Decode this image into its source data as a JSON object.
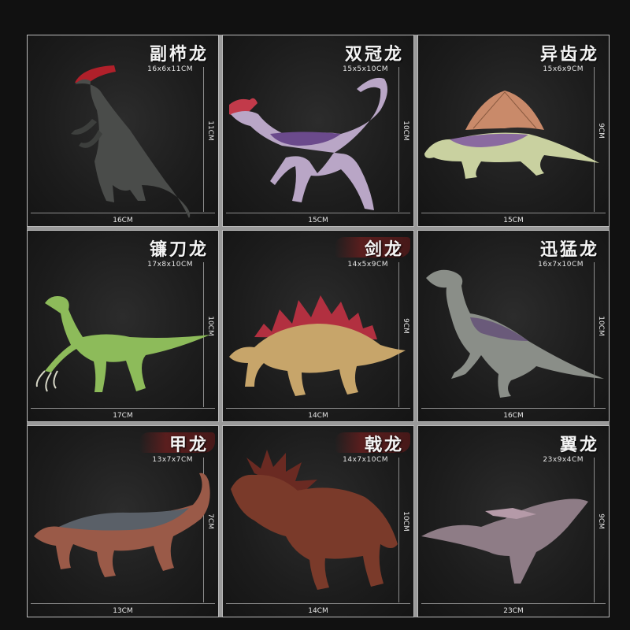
{
  "products": [
    {
      "name": "副栉龙",
      "dims": "16x6x11CM",
      "width_label": "16CM",
      "height_label": "11CM",
      "icon": "parasaurolophus-figure"
    },
    {
      "name": "双冠龙",
      "dims": "15x5x10CM",
      "width_label": "15CM",
      "height_label": "10CM",
      "icon": "dilophosaurus-figure"
    },
    {
      "name": "异齿龙",
      "dims": "15x6x9CM",
      "width_label": "15CM",
      "height_label": "9CM",
      "icon": "dimetrodon-figure"
    },
    {
      "name": "镰刀龙",
      "dims": "17x8x10CM",
      "width_label": "17CM",
      "height_label": "10CM",
      "icon": "therizinosaurus-figure"
    },
    {
      "name": "剑龙",
      "dims": "14x5x9CM",
      "width_label": "14CM",
      "height_label": "9CM",
      "icon": "stegosaurus-figure"
    },
    {
      "name": "迅猛龙",
      "dims": "16x7x10CM",
      "width_label": "16CM",
      "height_label": "10CM",
      "icon": "velociraptor-figure"
    },
    {
      "name": "甲龙",
      "dims": "13x7x7CM",
      "width_label": "13CM",
      "height_label": "7CM",
      "icon": "ankylosaurus-figure"
    },
    {
      "name": "戟龙",
      "dims": "14x7x10CM",
      "width_label": "14CM",
      "height_label": "10CM",
      "icon": "styracosaurus-figure"
    },
    {
      "name": "翼龙",
      "dims": "23x9x4CM",
      "width_label": "23CM",
      "height_label": "9CM",
      "icon": "pterosaur-figure"
    }
  ],
  "colors": {
    "background": "#111111",
    "panel": "#1c1c1c",
    "border": "#bbbbbb",
    "label_text": "#f4f4f4",
    "brush_red": "#6e1e1e"
  }
}
